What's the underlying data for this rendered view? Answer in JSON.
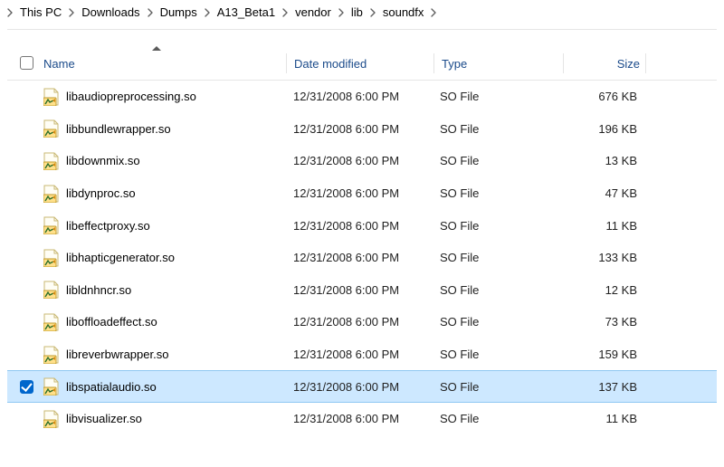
{
  "breadcrumb": [
    "This PC",
    "Downloads",
    "Dumps",
    "A13_Beta1",
    "vendor",
    "lib",
    "soundfx"
  ],
  "columns": {
    "name": "Name",
    "date": "Date modified",
    "type": "Type",
    "size": "Size"
  },
  "files": [
    {
      "name": "libaudiopreprocessing.so",
      "date": "12/31/2008 6:00 PM",
      "type": "SO File",
      "size": "676 KB",
      "selected": false
    },
    {
      "name": "libbundlewrapper.so",
      "date": "12/31/2008 6:00 PM",
      "type": "SO File",
      "size": "196 KB",
      "selected": false
    },
    {
      "name": "libdownmix.so",
      "date": "12/31/2008 6:00 PM",
      "type": "SO File",
      "size": "13 KB",
      "selected": false
    },
    {
      "name": "libdynproc.so",
      "date": "12/31/2008 6:00 PM",
      "type": "SO File",
      "size": "47 KB",
      "selected": false
    },
    {
      "name": "libeffectproxy.so",
      "date": "12/31/2008 6:00 PM",
      "type": "SO File",
      "size": "11 KB",
      "selected": false
    },
    {
      "name": "libhapticgenerator.so",
      "date": "12/31/2008 6:00 PM",
      "type": "SO File",
      "size": "133 KB",
      "selected": false
    },
    {
      "name": "libldnhncr.so",
      "date": "12/31/2008 6:00 PM",
      "type": "SO File",
      "size": "12 KB",
      "selected": false
    },
    {
      "name": "liboffloadeffect.so",
      "date": "12/31/2008 6:00 PM",
      "type": "SO File",
      "size": "73 KB",
      "selected": false
    },
    {
      "name": "libreverbwrapper.so",
      "date": "12/31/2008 6:00 PM",
      "type": "SO File",
      "size": "159 KB",
      "selected": false
    },
    {
      "name": "libspatialaudio.so",
      "date": "12/31/2008 6:00 PM",
      "type": "SO File",
      "size": "137 KB",
      "selected": true
    },
    {
      "name": "libvisualizer.so",
      "date": "12/31/2008 6:00 PM",
      "type": "SO File",
      "size": "11 KB",
      "selected": false
    }
  ],
  "icon_svg": "<svg viewBox='0 0 17 20'><path d='M1 1 h11 l4 4 v14 h-15 z' fill='#fffef5' stroke='#c9b873' stroke-width='1'/><path d='M12 1 v4 h4' fill='none' stroke='#c9b873' stroke-width='1'/><rect x='0' y='11' width='14' height='9' rx='1' fill='#ffe08a' stroke='#c29b2a' stroke-width='1'/><path d='M2 18 l3 -5 l2 3 l4 -2' fill='none' stroke='#2b6f2b' stroke-width='1.4'/><path d='M10 14 l3 -2 v4 z' fill='#d88a12'/></svg>",
  "chevron_svg": "<svg viewBox='0 0 6 10'><path d='M1 1 L5 5 L1 9' fill='none' stroke='#606060' stroke-width='1.4' stroke-linecap='round' stroke-linejoin='round'/></svg>"
}
